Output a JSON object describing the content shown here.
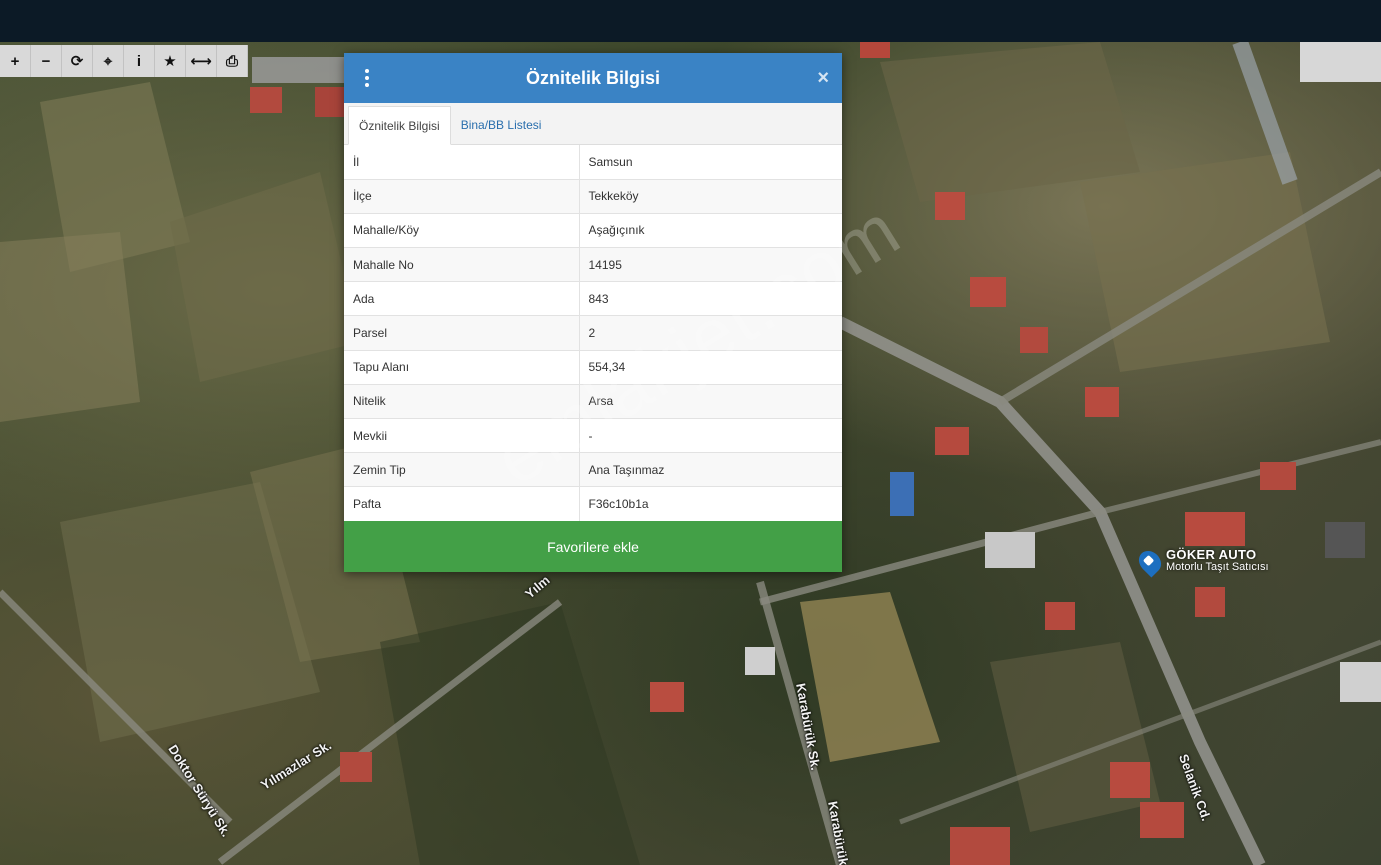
{
  "toolbar": {
    "buttons": [
      {
        "name": "zoom-in",
        "icon": "plus-icon",
        "glyph": "+"
      },
      {
        "name": "zoom-out",
        "icon": "minus-icon",
        "glyph": "−"
      },
      {
        "name": "refresh",
        "icon": "refresh-icon",
        "glyph": "⟳"
      },
      {
        "name": "locate",
        "icon": "crosshair-icon",
        "glyph": "⌖"
      },
      {
        "name": "info",
        "icon": "info-icon",
        "glyph": "i"
      },
      {
        "name": "favorite",
        "icon": "star-icon",
        "glyph": "★"
      },
      {
        "name": "measure",
        "icon": "arrows-horizontal-icon",
        "glyph": "⟷"
      },
      {
        "name": "print",
        "icon": "print-icon",
        "glyph": "⎙"
      }
    ]
  },
  "map": {
    "streets": [
      "Yılmazlar Sk.",
      "Doktor Süryü Sk.",
      "Karabürük Sk.",
      "Karabürük",
      "Selanik Cd.",
      "Yılm"
    ],
    "poi": {
      "name": "GÖKER AUTO",
      "type": "Motorlu Taşıt Satıcısı"
    },
    "watermark": "emlakjet.com"
  },
  "modal": {
    "title": "Öznitelik Bilgisi",
    "tabs": [
      {
        "label": "Öznitelik Bilgisi",
        "active": true
      },
      {
        "label": "Bina/BB Listesi",
        "active": false
      }
    ],
    "rows": [
      {
        "key": "İl",
        "value": "Samsun"
      },
      {
        "key": "İlçe",
        "value": "Tekkeköy"
      },
      {
        "key": "Mahalle/Köy",
        "value": "Aşağıçınık"
      },
      {
        "key": "Mahalle No",
        "value": "14195"
      },
      {
        "key": "Ada",
        "value": "843"
      },
      {
        "key": "Parsel",
        "value": "2"
      },
      {
        "key": "Tapu Alanı",
        "value": "554,34"
      },
      {
        "key": "Nitelik",
        "value": "Arsa"
      },
      {
        "key": "Mevkii",
        "value": "-"
      },
      {
        "key": "Zemin Tip",
        "value": "Ana Taşınmaz"
      },
      {
        "key": "Pafta",
        "value": "F36c10b1a"
      }
    ],
    "favorite_label": "Favorilere ekle"
  },
  "colors": {
    "header": "#3a83c5",
    "favorite_button": "#43a047",
    "topbar": "#0c1a26"
  }
}
